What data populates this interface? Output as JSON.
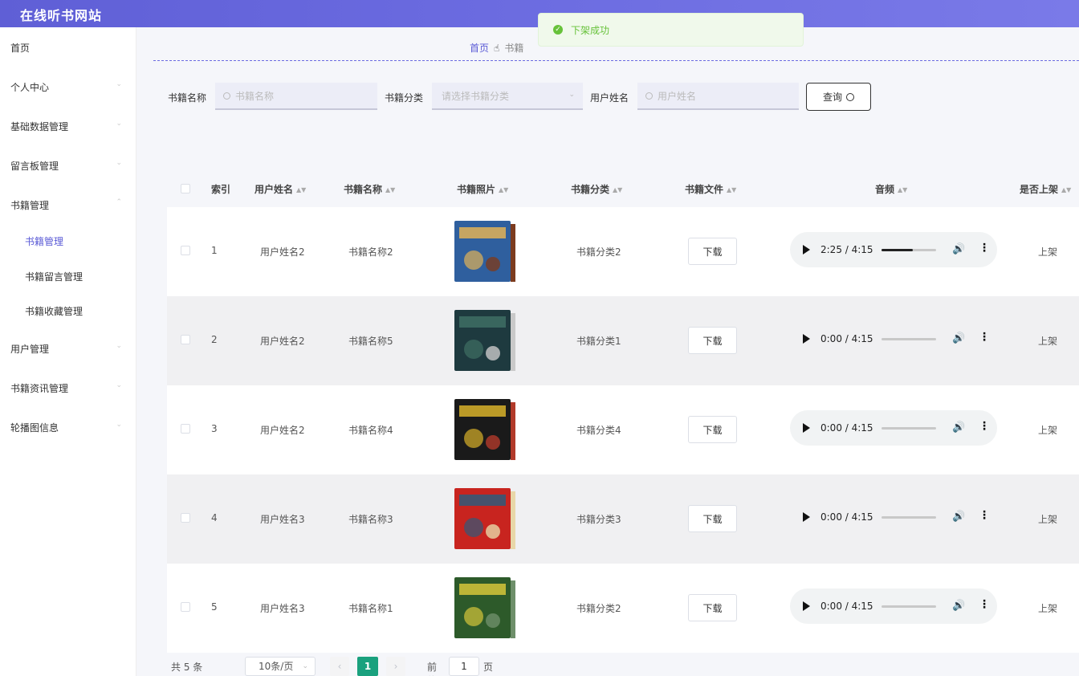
{
  "header": {
    "title": "在线听书网站"
  },
  "toast": {
    "message": "下架成功"
  },
  "sidebar": {
    "items": [
      {
        "label": "首页"
      },
      {
        "label": "个人中心"
      },
      {
        "label": "基础数据管理"
      },
      {
        "label": "留言板管理"
      },
      {
        "label": "书籍管理"
      },
      {
        "label": "用户管理"
      },
      {
        "label": "书籍资讯管理"
      },
      {
        "label": "轮播图信息"
      }
    ],
    "sub_items": [
      {
        "label": "书籍管理",
        "active": true
      },
      {
        "label": "书籍留言管理"
      },
      {
        "label": "书籍收藏管理"
      }
    ]
  },
  "breadcrumb": {
    "home": "首页",
    "current": "书籍"
  },
  "search": {
    "name_label": "书籍名称",
    "name_placeholder": "书籍名称",
    "category_label": "书籍分类",
    "category_placeholder": "请选择书籍分类",
    "user_label": "用户姓名",
    "user_placeholder": "用户姓名",
    "query_label": "查询"
  },
  "table": {
    "headers": {
      "index": "索引",
      "user": "用户姓名",
      "book": "书籍名称",
      "photo": "书籍照片",
      "category": "书籍分类",
      "file": "书籍文件",
      "audio": "音频",
      "status": "是否上架"
    },
    "download_label": "下载",
    "rows": [
      {
        "index": "1",
        "user": "用户姓名2",
        "book": "书籍名称2",
        "category": "书籍分类2",
        "time": "2:25 / 4:15",
        "progress": 0.57,
        "status": "上架"
      },
      {
        "index": "2",
        "user": "用户姓名2",
        "book": "书籍名称5",
        "category": "书籍分类1",
        "time": "0:00 / 4:15",
        "progress": 0,
        "status": "上架"
      },
      {
        "index": "3",
        "user": "用户姓名2",
        "book": "书籍名称4",
        "category": "书籍分类4",
        "time": "0:00 / 4:15",
        "progress": 0,
        "status": "上架"
      },
      {
        "index": "4",
        "user": "用户姓名3",
        "book": "书籍名称3",
        "category": "书籍分类3",
        "time": "0:00 / 4:15",
        "progress": 0,
        "status": "上架"
      },
      {
        "index": "5",
        "user": "用户姓名3",
        "book": "书籍名称1",
        "category": "书籍分类2",
        "time": "0:00 / 4:15",
        "progress": 0,
        "status": "上架"
      }
    ]
  },
  "pager": {
    "total": "共 5 条",
    "page_size": "10条/页",
    "prev": "‹",
    "current": "1",
    "next": "›",
    "goto_label": "前往",
    "goto_value": "1",
    "goto_suffix": "页"
  },
  "colors": {
    "accent": "#5b5bd6",
    "success": "#67c23a",
    "page_active": "#1aa17e"
  }
}
